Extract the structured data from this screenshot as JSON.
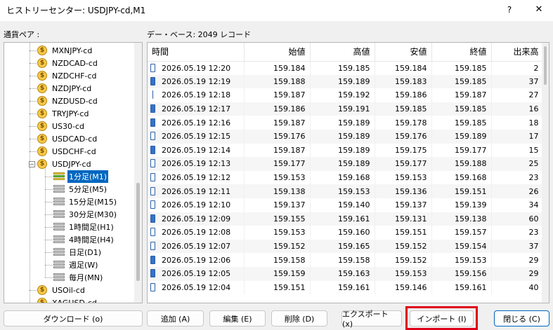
{
  "window": {
    "title": "ヒストリーセンター: USDJPY-cd,M1",
    "help": "?",
    "close": "✕"
  },
  "left_label": "通貨ペア :",
  "db_label": "デー・ベース: 2049 レコード",
  "tree": {
    "symbols_top": [
      "MXNJPY-cd",
      "NZDCAD-cd",
      "NZDCHF-cd",
      "NZDJPY-cd",
      "NZDUSD-cd",
      "TRYJPY-cd",
      "US30-cd",
      "USDCAD-cd",
      "USDCHF-cd"
    ],
    "expanded_symbol": "USDJPY-cd",
    "expand_glyph": "−",
    "timeframes": [
      "1分足(M1)",
      "5分足(M5)",
      "15分足(M15)",
      "30分足(M30)",
      "1時間足(H1)",
      "4時間足(H4)",
      "日足(D1)",
      "週足(W)",
      "毎月(MN)"
    ],
    "symbols_bottom": [
      "USOil-cd",
      "XAGUSD-cd"
    ],
    "coin_glyph": "$"
  },
  "table": {
    "headers": [
      "時間",
      "始値",
      "高値",
      "安値",
      "終値",
      "出来高"
    ],
    "rows": [
      {
        "type": "bull",
        "time": "2026.05.19 12:20",
        "open": "159.184",
        "high": "159.185",
        "low": "159.184",
        "close": "159.185",
        "volume": "2"
      },
      {
        "type": "bear",
        "time": "2026.05.19 12:19",
        "open": "159.188",
        "high": "159.189",
        "low": "159.183",
        "close": "159.185",
        "volume": "37"
      },
      {
        "type": "doji",
        "time": "2026.05.19 12:18",
        "open": "159.187",
        "high": "159.192",
        "low": "159.186",
        "close": "159.187",
        "volume": "27"
      },
      {
        "type": "bear",
        "time": "2026.05.19 12:17",
        "open": "159.186",
        "high": "159.191",
        "low": "159.185",
        "close": "159.185",
        "volume": "16"
      },
      {
        "type": "bear",
        "time": "2026.05.19 12:16",
        "open": "159.187",
        "high": "159.189",
        "low": "159.178",
        "close": "159.185",
        "volume": "18"
      },
      {
        "type": "bull",
        "time": "2026.05.19 12:15",
        "open": "159.176",
        "high": "159.189",
        "low": "159.176",
        "close": "159.189",
        "volume": "17"
      },
      {
        "type": "bear",
        "time": "2026.05.19 12:14",
        "open": "159.187",
        "high": "159.189",
        "low": "159.175",
        "close": "159.177",
        "volume": "15"
      },
      {
        "type": "bull",
        "time": "2026.05.19 12:13",
        "open": "159.177",
        "high": "159.189",
        "low": "159.177",
        "close": "159.188",
        "volume": "25"
      },
      {
        "type": "bull",
        "time": "2026.05.19 12:12",
        "open": "159.153",
        "high": "159.168",
        "low": "159.153",
        "close": "159.168",
        "volume": "23"
      },
      {
        "type": "bull",
        "time": "2026.05.19 12:11",
        "open": "159.138",
        "high": "159.153",
        "low": "159.136",
        "close": "159.151",
        "volume": "26"
      },
      {
        "type": "bull",
        "time": "2026.05.19 12:10",
        "open": "159.137",
        "high": "159.140",
        "low": "159.137",
        "close": "159.139",
        "volume": "34"
      },
      {
        "type": "bear",
        "time": "2026.05.19 12:09",
        "open": "159.155",
        "high": "159.161",
        "low": "159.131",
        "close": "159.138",
        "volume": "60"
      },
      {
        "type": "bull",
        "time": "2026.05.19 12:08",
        "open": "159.153",
        "high": "159.160",
        "low": "159.151",
        "close": "159.157",
        "volume": "23"
      },
      {
        "type": "bull",
        "time": "2026.05.19 12:07",
        "open": "159.152",
        "high": "159.165",
        "low": "159.152",
        "close": "159.154",
        "volume": "37"
      },
      {
        "type": "bear",
        "time": "2026.05.19 12:06",
        "open": "159.158",
        "high": "159.158",
        "low": "159.152",
        "close": "159.153",
        "volume": "29"
      },
      {
        "type": "bear",
        "time": "2026.05.19 12:05",
        "open": "159.159",
        "high": "159.163",
        "low": "159.153",
        "close": "159.156",
        "volume": "29"
      },
      {
        "type": "bull",
        "time": "2026.05.19 12:04",
        "open": "159.151",
        "high": "159.161",
        "low": "159.146",
        "close": "159.161",
        "volume": "40"
      }
    ]
  },
  "buttons": {
    "download": "ダウンロード (o)",
    "add": "追加 (A)",
    "edit": "編集 (E)",
    "delete": "削除 (D)",
    "export": "エクスポート (x)",
    "import": "インポート (I)",
    "close": "閉じる (C)"
  },
  "colors": {
    "selection": "#0067c0",
    "highlight": "#e0001b",
    "coin": "#f7c94a"
  }
}
